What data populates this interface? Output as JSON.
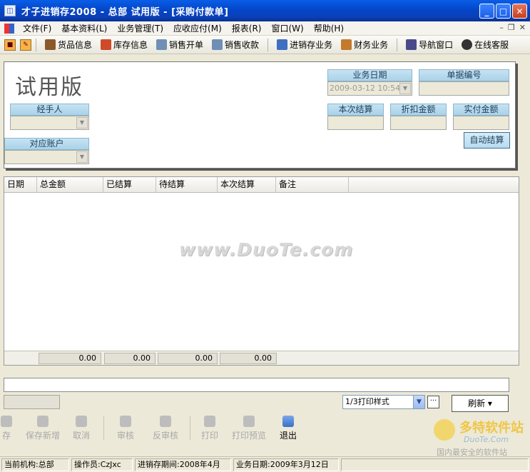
{
  "window": {
    "title": "才子进销存2008 - 总部  试用版 - [采购付款单]",
    "minimize_label": "_",
    "maximize_label": "□",
    "close_label": "✕"
  },
  "menu": {
    "items": [
      {
        "label": "文件(F)"
      },
      {
        "label": "基本资料(L)"
      },
      {
        "label": "业务管理(T)"
      },
      {
        "label": "应收应付(M)"
      },
      {
        "label": "报表(R)"
      },
      {
        "label": "窗口(W)"
      },
      {
        "label": "帮助(H)"
      }
    ],
    "mdi_minimize": "–",
    "mdi_restore": "❐",
    "mdi_close": "✕"
  },
  "toolbar": {
    "items": [
      {
        "label": "货品信息",
        "icon": "goods-icon",
        "color": "#8b5a2b"
      },
      {
        "label": "库存信息",
        "icon": "house-icon",
        "color": "#d04a2a"
      },
      {
        "label": "销售开单",
        "icon": "sales-order-icon",
        "color": "#6f8fb5"
      },
      {
        "label": "销售收款",
        "icon": "sales-receipt-icon",
        "color": "#6f8fb5"
      },
      {
        "label": "进销存业务",
        "icon": "inventory-business-icon",
        "color": "#3f6fc0"
      },
      {
        "label": "财务业务",
        "icon": "finance-icon",
        "color": "#c47a2c"
      },
      {
        "label": "导航窗口",
        "icon": "navigation-icon",
        "color": "#4a4a8a"
      },
      {
        "label": "在线客服",
        "icon": "online-support-icon",
        "color": "#333333"
      }
    ]
  },
  "form": {
    "big_title": "试用版",
    "handler_label": "经手人",
    "handler_value": "",
    "account_label": "对应账户",
    "account_value": "",
    "date_label": "业务日期",
    "date_value": "2009-03-12 10:54",
    "doc_no_label": "单据编号",
    "doc_no_value": "",
    "current_settle_label": "本次结算",
    "current_settle_value": "",
    "discount_label": "折扣金额",
    "discount_value": "",
    "actual_pay_label": "实付金额",
    "actual_pay_value": "",
    "auto_settle_label": "自动结算"
  },
  "grid": {
    "columns": [
      "日期",
      "总金额",
      "已结算",
      "待结算",
      "本次结算",
      "备注"
    ],
    "totals": [
      "0.00",
      "0.00",
      "0.00",
      "0.00"
    ],
    "watermark": "www.DuoTe.com"
  },
  "bottom": {
    "print_style": "1/3打印样式",
    "dots_label": "···",
    "refresh_label": "刷新 ▾"
  },
  "actions": [
    {
      "label": "存",
      "enabled": false
    },
    {
      "label": "保存新增",
      "enabled": false
    },
    {
      "label": "取消",
      "enabled": false
    },
    {
      "label": "审核",
      "enabled": false
    },
    {
      "label": "反审核",
      "enabled": false
    },
    {
      "label": "打印",
      "enabled": false
    },
    {
      "label": "打印预览",
      "enabled": false
    },
    {
      "label": "退出",
      "enabled": true
    }
  ],
  "logo": {
    "main": "多特软件站",
    "sub": "DuoTe.Com",
    "tag": "国内最安全的软件站"
  },
  "status": {
    "org": "当前机构:总部",
    "operator": "操作员:CzJxc",
    "period": "进销存期间:2008年4月",
    "biz_date": "业务日期:2009年3月12日"
  }
}
